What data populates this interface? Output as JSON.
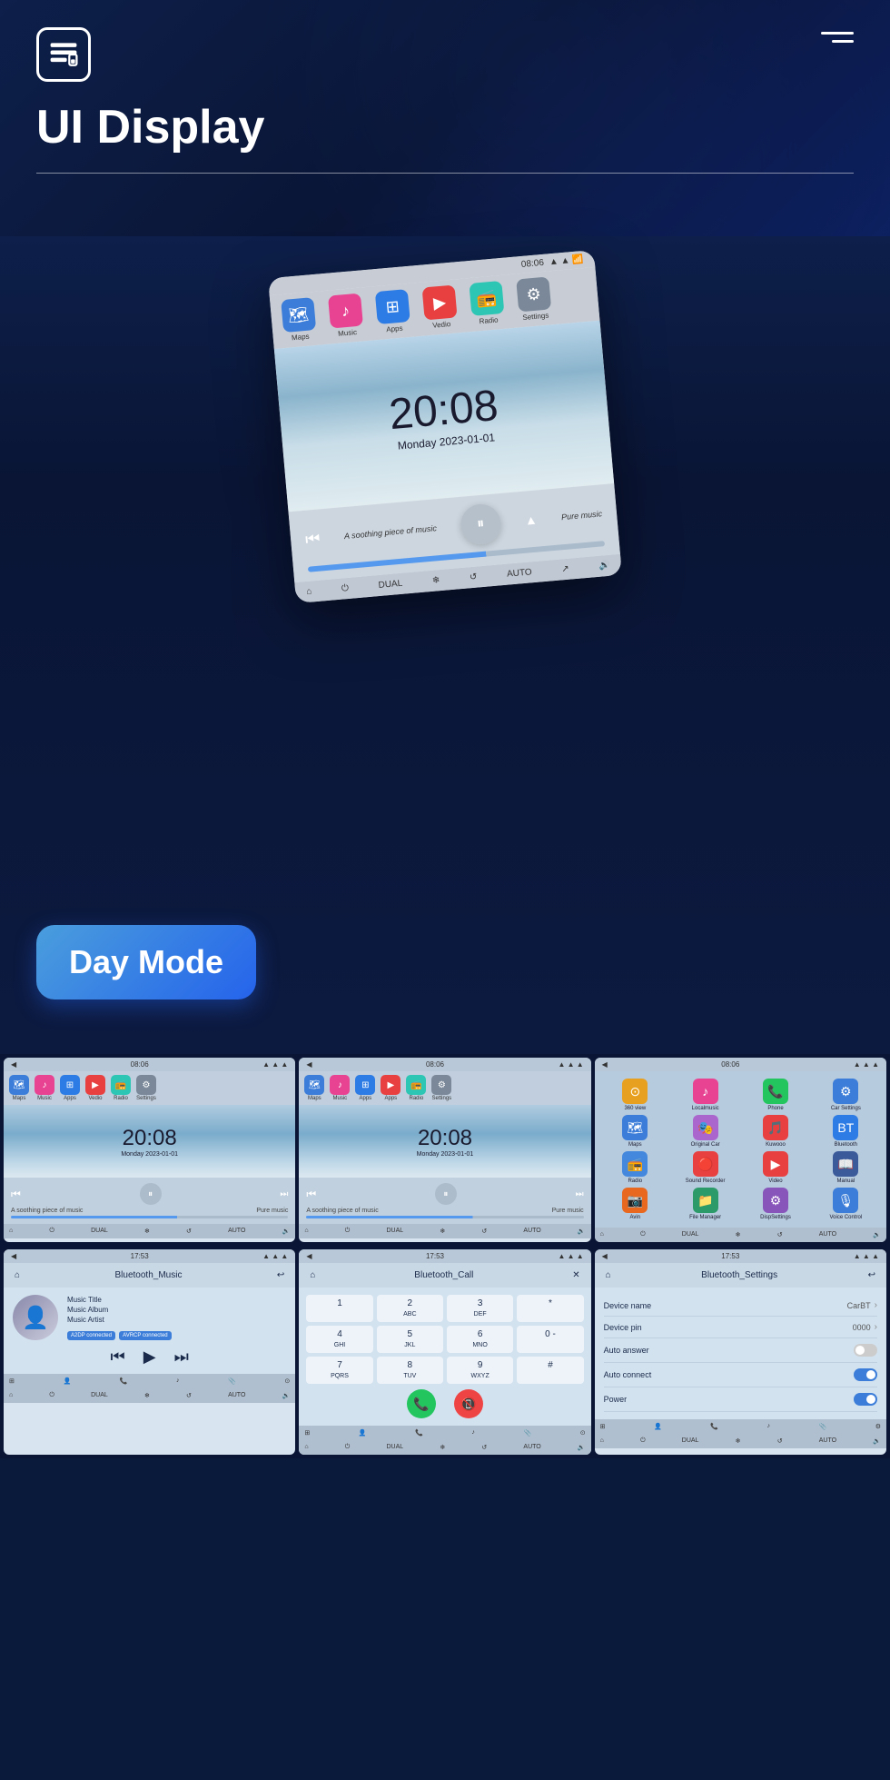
{
  "header": {
    "title": "UI Display",
    "menu_icon": "≡"
  },
  "large_mockup": {
    "status_time": "08:06",
    "nav_apps": [
      {
        "label": "Maps",
        "color": "icon-blue",
        "icon": "🗺"
      },
      {
        "label": "Music",
        "color": "icon-pink",
        "icon": "♪"
      },
      {
        "label": "Apps",
        "color": "icon-grid",
        "icon": "⊞"
      },
      {
        "label": "Vedio",
        "color": "icon-red",
        "icon": "▶"
      },
      {
        "label": "Radio",
        "color": "icon-teal",
        "icon": "📻"
      },
      {
        "label": "Settings",
        "color": "icon-gray",
        "icon": "⚙"
      }
    ],
    "time": "20:08",
    "date": "Monday  2023-01-01",
    "music_text": "A soothing piece of music",
    "music_label": "Pure music",
    "bottom_labels": [
      "DUAL",
      "AUTO"
    ]
  },
  "day_mode": {
    "label": "Day Mode"
  },
  "grid_row1": [
    {
      "status_time": "08:06",
      "type": "home",
      "time": "20:08",
      "date": "Monday  2023-01-01",
      "music_text": "A soothing piece of music",
      "music_label": "Pure music"
    },
    {
      "status_time": "08:06",
      "type": "home",
      "time": "20:08",
      "date": "Monday  2023-01-01",
      "music_text": "A soothing piece of music",
      "music_label": "Pure music"
    },
    {
      "status_time": "08:06",
      "type": "apps",
      "apps": [
        {
          "label": "360 view",
          "color": "#e8a020",
          "icon": "⊙"
        },
        {
          "label": "Localmusic",
          "color": "#e84393",
          "icon": "♪"
        },
        {
          "label": "Phone",
          "color": "#22c55e",
          "icon": "📞"
        },
        {
          "label": "Car Settings",
          "color": "#3b7dd8",
          "icon": "⚙"
        },
        {
          "label": "Maps",
          "color": "#3b7dd8",
          "icon": "🗺"
        },
        {
          "label": "Original Car",
          "color": "#aa66cc",
          "icon": "🎭"
        },
        {
          "label": "Kuwooo",
          "color": "#e84040",
          "icon": "🎵"
        },
        {
          "label": "Bluetooth",
          "color": "#2d7be4",
          "icon": "B"
        },
        {
          "label": "Radio",
          "color": "#4488dd",
          "icon": "📻"
        },
        {
          "label": "Sound Recorder",
          "color": "#e84040",
          "icon": "🔴"
        },
        {
          "label": "Video",
          "color": "#e84040",
          "icon": "▶"
        },
        {
          "label": "Manual",
          "color": "#3b5a9a",
          "icon": "📖"
        },
        {
          "label": "Avin",
          "color": "#e86820",
          "icon": "📷"
        },
        {
          "label": "File Manager",
          "color": "#2d9a6a",
          "icon": "📁"
        },
        {
          "label": "DispSettings",
          "color": "#8855bb",
          "icon": "⚙"
        },
        {
          "label": "Voice Control",
          "color": "#3b7dd8",
          "icon": "🎙"
        }
      ]
    }
  ],
  "grid_row2": [
    {
      "status_time": "17:53",
      "type": "bt_music",
      "header_title": "Bluetooth_Music",
      "music_title": "Music Title",
      "music_album": "Music Album",
      "music_artist": "Music Artist",
      "badge1": "A2DP connected",
      "badge2": "AVRCP connected"
    },
    {
      "status_time": "17:53",
      "type": "bt_call",
      "header_title": "Bluetooth_Call",
      "dial_keys": [
        "1",
        "2 ABC",
        "3 DEF",
        "*",
        "4 GHI",
        "5 JKL",
        "6 MNO",
        "0 -",
        "7 PQRS",
        "8 TUV",
        "9 WXYZ",
        "#"
      ]
    },
    {
      "status_time": "17:53",
      "type": "bt_settings",
      "header_title": "Bluetooth_Settings",
      "settings": [
        {
          "label": "Device name",
          "value": "CarBT",
          "type": "nav"
        },
        {
          "label": "Device pin",
          "value": "0000",
          "type": "nav"
        },
        {
          "label": "Auto answer",
          "value": "",
          "type": "toggle",
          "state": "off"
        },
        {
          "label": "Auto connect",
          "value": "",
          "type": "toggle",
          "state": "on"
        },
        {
          "label": "Power",
          "value": "",
          "type": "toggle",
          "state": "on"
        }
      ]
    }
  ]
}
